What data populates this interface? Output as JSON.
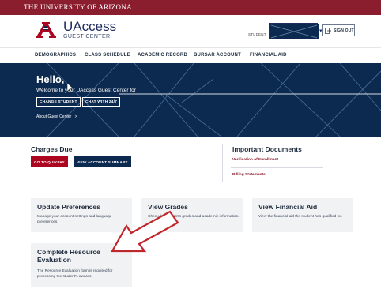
{
  "topbar": {
    "university": "THE UNIVERSITY OF ARIZONA"
  },
  "brand": {
    "name": "UAccess",
    "subtitle": "GUEST CENTER"
  },
  "header": {
    "student_label": "STUDENT",
    "signout_label": "SIGN OUT"
  },
  "nav": {
    "items": [
      "DEMOGRAPHICS",
      "CLASS SCHEDULE",
      "ACADEMIC RECORD",
      "BURSAR ACCOUNT",
      "FINANCIAL AID"
    ]
  },
  "hero": {
    "greeting": "Hello,",
    "welcome": "Welcome to your UAccess Guest Center for",
    "change_student": "CHANGE STUDENT",
    "chat": "CHAT WITH 24/7",
    "about": "About Guest Center",
    "about_chevron": ">"
  },
  "charges": {
    "title": "Charges Due",
    "quickpay": "GO TO QUIKPAY",
    "summary": "VIEW ACCOUNT SUMMARY"
  },
  "documents": {
    "title": "Important Documents",
    "links": [
      "Verification of Enrollment",
      "Billing Statements"
    ]
  },
  "cards": [
    {
      "title": "Update Preferences",
      "body": "Manage your account settings and language preferences."
    },
    {
      "title": "View Grades",
      "body": "Check the student's grades and academic information."
    },
    {
      "title": "View Financial Aid",
      "body": "View the financial aid the student has qualified for."
    },
    {
      "title": "Complete Resource Evaluation",
      "body": "The Resource Evaluation form is required for processing the student's awards."
    }
  ],
  "colors": {
    "topbar": "#8a1e2f",
    "navy": "#0c2a4f",
    "red": "#ab0520",
    "arrow": "#c0272d"
  }
}
